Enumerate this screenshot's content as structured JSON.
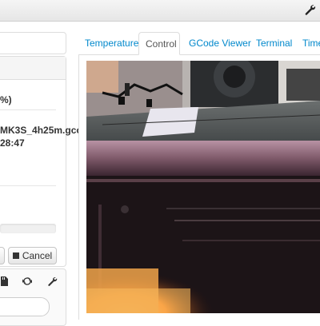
{
  "sidebar": {
    "progress_pct": "%)",
    "file_name": "MK3S_4h25m.gco",
    "print_time": "28:47",
    "cancel_label": "Cancel"
  },
  "tabs": [
    {
      "label": "Temperature",
      "active": false
    },
    {
      "label": "Control",
      "active": true
    },
    {
      "label": "GCode Viewer",
      "active": false
    },
    {
      "label": "Terminal",
      "active": false
    },
    {
      "label": "Time",
      "active": false
    }
  ],
  "webcam": {
    "label": "Webcam stream"
  },
  "icons": {
    "settings": "wrench-icon",
    "stop": "stop-icon",
    "refresh": "refresh-icon",
    "sd": "sd-card-icon"
  }
}
